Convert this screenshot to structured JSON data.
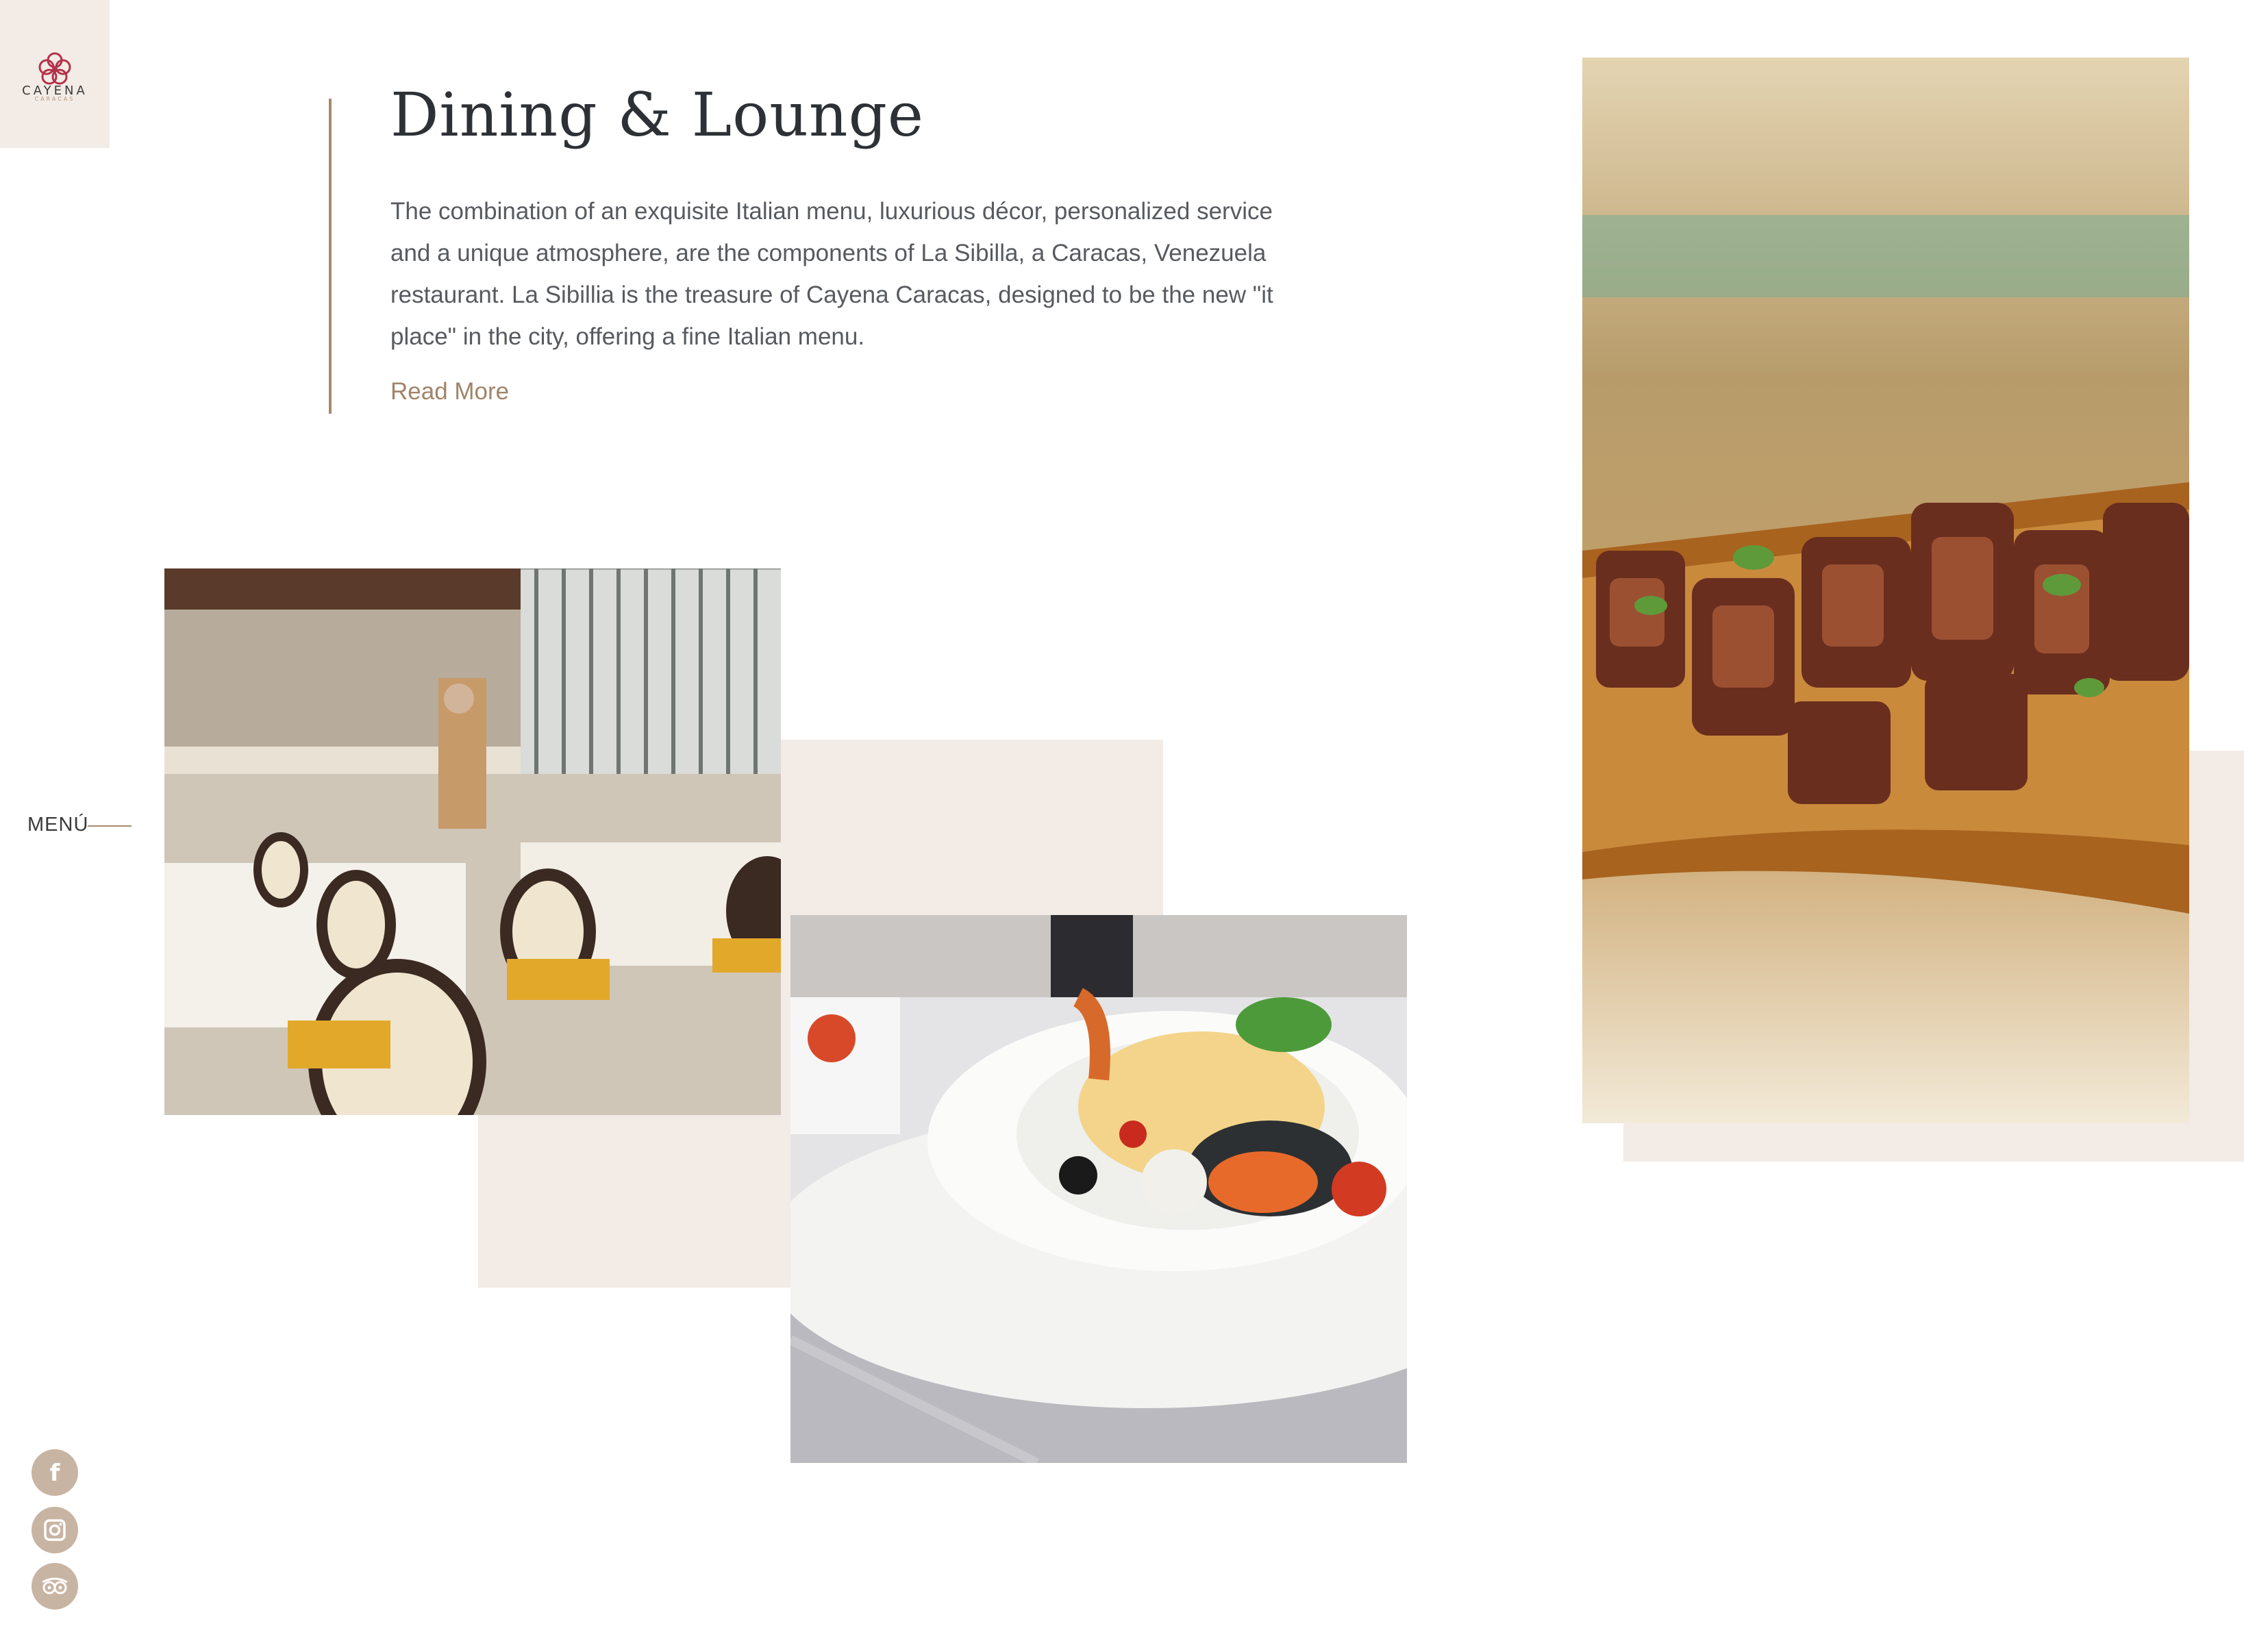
{
  "brand": {
    "name": "CAYENA",
    "sub": "CARACAS"
  },
  "section": {
    "title": "Dining & Lounge",
    "description": "The combination of an exquisite Italian menu, luxurious décor, personalized service and a unique atmosphere, are the components of La Sibilla, a Caracas, Venezuela restaurant. La Sibillia is the treasure of Cayena Caracas, designed to be the new \"it place\" in the city, offering a fine Italian menu.",
    "read_more": "Read More"
  },
  "nav": {
    "menu_label": "MENÚ"
  },
  "social": [
    {
      "icon": "facebook-icon"
    },
    {
      "icon": "instagram-icon"
    },
    {
      "icon": "tripadvisor-icon"
    }
  ],
  "colors": {
    "accent": "#a8896c",
    "beige": "#f2ebe6",
    "heading": "#2d3136",
    "text": "#575a5e",
    "social_bg": "#c8b4a2",
    "logo_red": "#b5314a"
  }
}
